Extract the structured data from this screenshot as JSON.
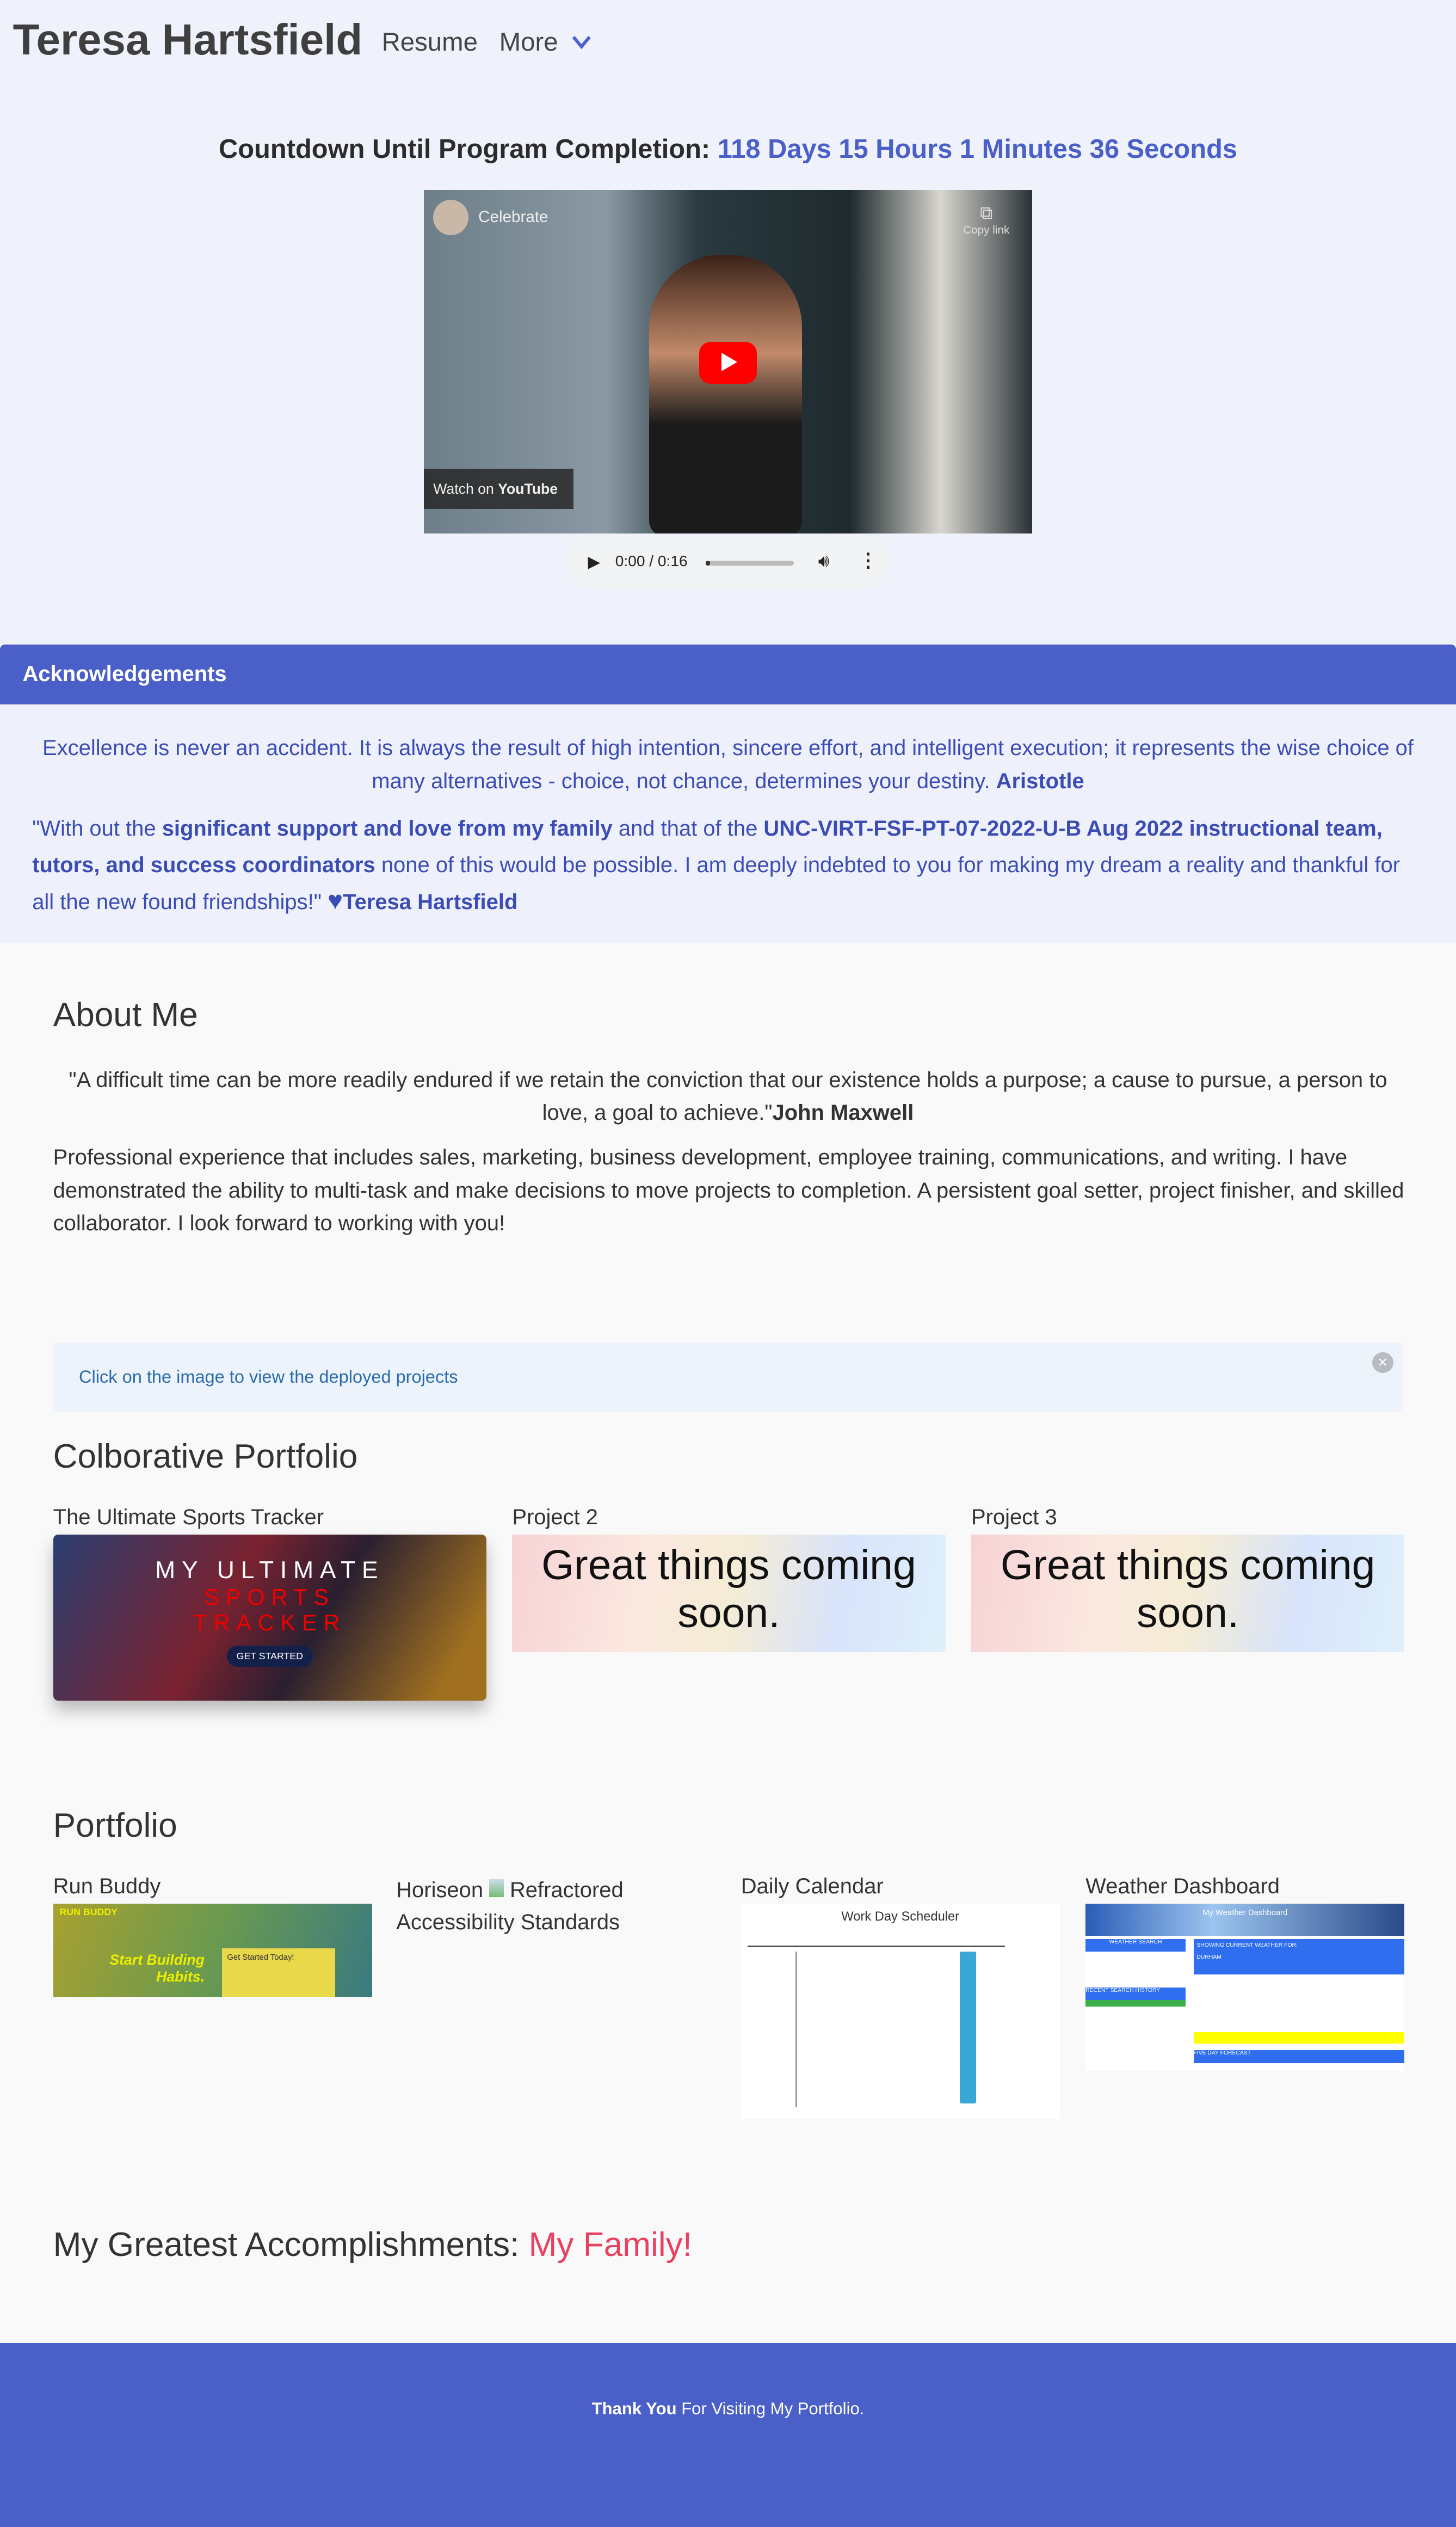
{
  "header": {
    "name": "Teresa Hartsfield",
    "nav": [
      "Resume",
      "More"
    ]
  },
  "countdown": {
    "label": "Countdown Until Program Completion:",
    "value": "118 Days 15 Hours 1 Minutes 36 Seconds"
  },
  "video": {
    "title": "Celebrate",
    "copy_link": "Copy link",
    "watch_on": "Watch on",
    "youtube": "YouTube"
  },
  "audio": {
    "time": "0:00 / 0:16",
    "progress": 0.05
  },
  "acknowledgements": {
    "title": "Acknowledgements",
    "quote": "Excellence is never an accident. It is always the result of high intention, sincere effort, and intelligent execution; it represents the wise choice of many alternatives - choice, not chance, determines your destiny.",
    "quote_author": "Aristotle",
    "thanks_1": "\"With out the ",
    "thanks_b1": "significant support and love from my family",
    "thanks_2": " and that of the ",
    "thanks_b2": "UNC-VIRT-FSF-PT-07-2022-U-B Aug 2022 instructional team, tutors, and success coordinators",
    "thanks_3": " none of this would be possible. I am deeply indebted to you for making my dream a reality and thankful for all the new found friendships!\" ",
    "heart": "♥",
    "signature": "Teresa Hartsfield"
  },
  "about": {
    "title": "About Me",
    "quote": "\"A difficult time can be more readily endured if we retain the conviction that our existence holds a purpose; a cause to pursue, a person to love, a goal to achieve.\"",
    "quote_author": "John Maxwell",
    "paragraph": "Professional experience that includes sales, marketing, business development, employee training, communications, and writing. I have demonstrated the ability to multi-task and make decisions to move projects to completion. A persistent goal setter, project finisher, and skilled collaborator. I look forward to working with you!"
  },
  "alert": {
    "text": "Click on the image to view the deployed projects",
    "close": "×"
  },
  "collab": {
    "title": "Colborative Portfolio",
    "projects": [
      {
        "title": "The Ultimate Sports Tracker",
        "line1": "MY ULTIMATE",
        "line2": "SPORTS",
        "line3": "TRACKER",
        "button": "GET STARTED"
      },
      {
        "title": "Project 2",
        "text": "Great things coming soon."
      },
      {
        "title": "Project 3",
        "text": "Great things coming soon."
      }
    ]
  },
  "portfolio": {
    "title": "Portfolio",
    "items": [
      {
        "title": "Run Buddy",
        "brand": "RUN BUDDY",
        "headline": "Start Building Habits.",
        "cta": "Get Started Today!"
      },
      {
        "title": "Horiseon",
        "title2": "Refractored Accessibility Standards"
      },
      {
        "title": "Daily Calendar",
        "heading": "Work Day Scheduler"
      },
      {
        "title": "Weather Dashboard",
        "heading": "My Weather Dashboard",
        "search": "WEATHER SEARCH",
        "history": "RECENT SEARCH HISTORY",
        "current": "SHOWING CURRENT WEATHER FOR:",
        "city": "DURHAM",
        "forecast": "FIVE DAY FORECAST"
      }
    ]
  },
  "accomplishments": {
    "label": "My Greatest Accomplishments:",
    "value": "My Family!",
    "accent": "#e8405f"
  },
  "footer": {
    "bold": "Thank You",
    "rest": " For Visiting My Portfolio."
  },
  "colors": {
    "primary": "#4a5fc8",
    "ack_bg": "#eef1fb"
  }
}
